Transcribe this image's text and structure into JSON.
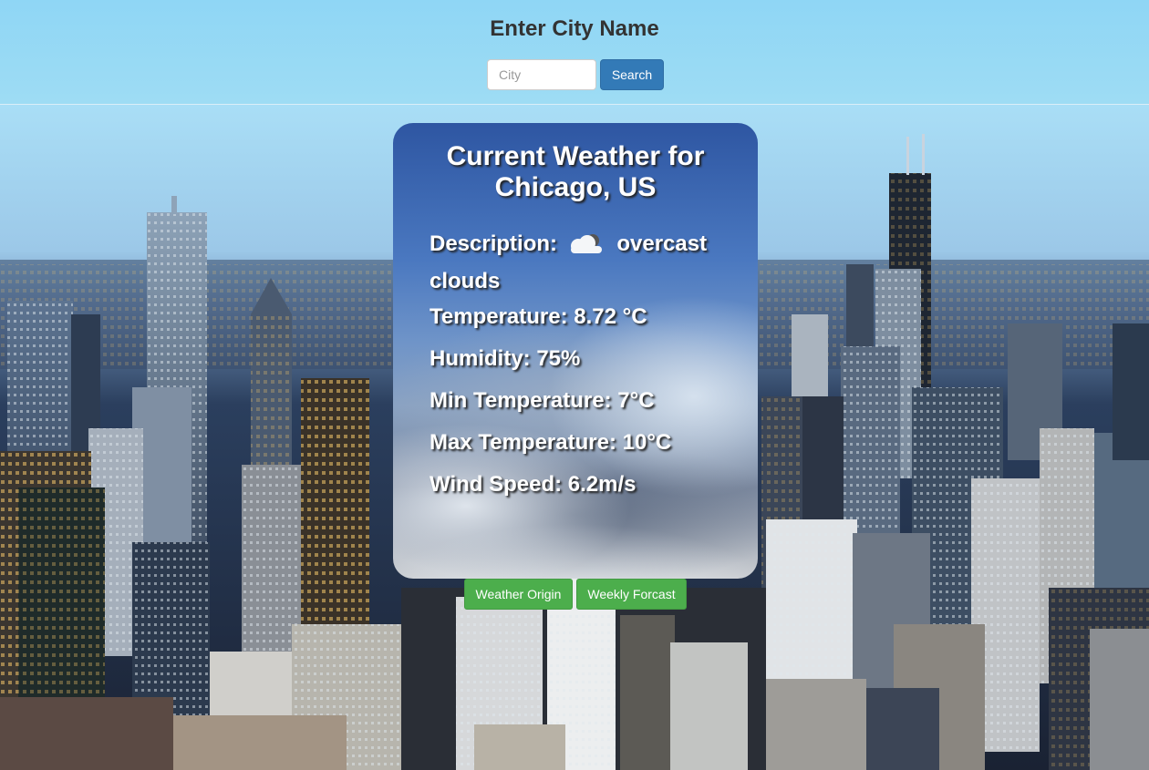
{
  "header": {
    "title": "Enter City Name",
    "city_placeholder": "City",
    "search_label": "Search"
  },
  "weather": {
    "title": "Current Weather for Chicago, US",
    "description_label": "Description:",
    "description_icon": "cloud-icon",
    "description_value": "overcast clouds",
    "temperature": "Temperature: 8.72 °C",
    "humidity": "Humidity: 75%",
    "min_temperature": "Min Temperature: 7°C",
    "max_temperature": "Max Temperature: 10°C",
    "wind_speed": "Wind Speed: 6.2m/s"
  },
  "actions": {
    "weather_origin_label": "Weather Origin",
    "weekly_forecast_label": "Weekly Forcast"
  },
  "colors": {
    "search_button": "#337ab7",
    "action_buttons": "#4cae4c",
    "header_bg": "#8fd6f5"
  }
}
